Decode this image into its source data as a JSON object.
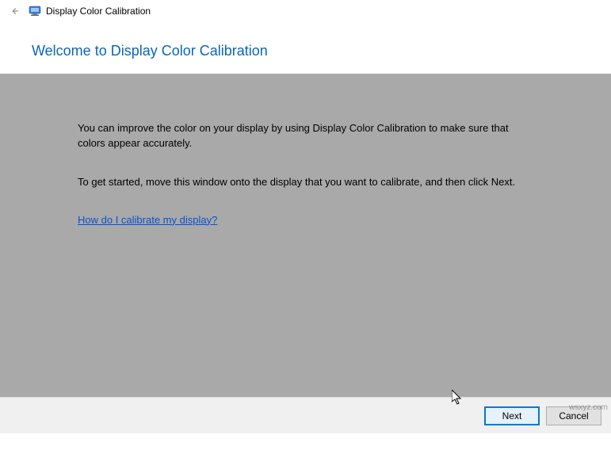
{
  "titlebar": {
    "title": "Display Color Calibration"
  },
  "heading": "Welcome to Display Color Calibration",
  "content": {
    "paragraph1": "You can improve the color on your display by using Display Color Calibration to make sure that colors appear accurately.",
    "paragraph2": "To get started, move this window onto the display that you want to calibrate, and then click Next.",
    "help_link": "How do I calibrate my display?"
  },
  "footer": {
    "next": "Next",
    "cancel": "Cancel"
  },
  "watermark": "wsxyz.com"
}
